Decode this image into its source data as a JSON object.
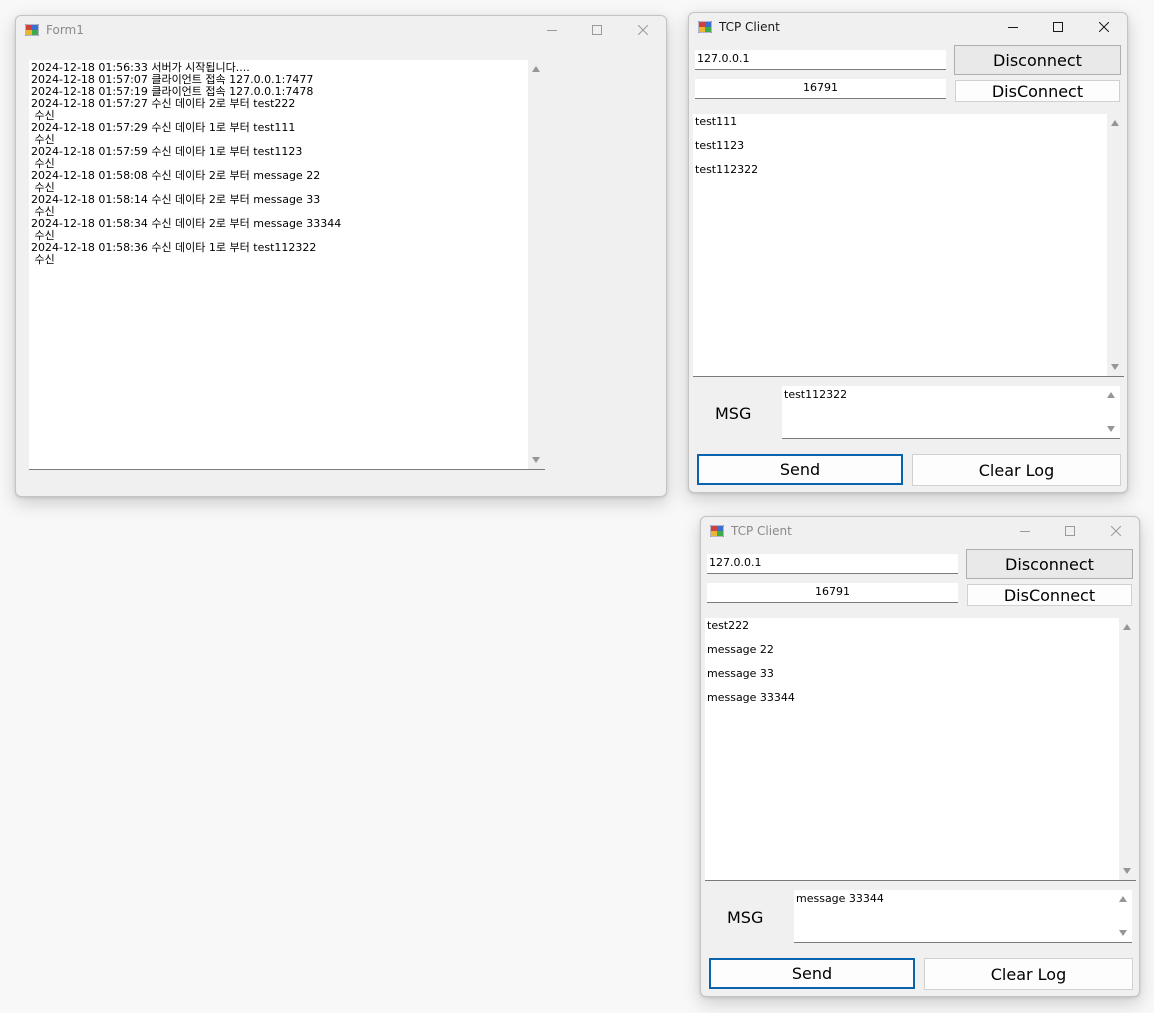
{
  "server": {
    "title": "Form1",
    "log": [
      "2024-12-18 01:56:33 서버가 시작됩니다....",
      "2024-12-18 01:57:07 클라이언트 접속 127.0.0.1:7477",
      "2024-12-18 01:57:19 클라이언트 접속 127.0.0.1:7478",
      "2024-12-18 01:57:27 수신 데이타 2로 부터 test222",
      " 수신",
      "2024-12-18 01:57:29 수신 데이타 1로 부터 test111",
      " 수신",
      "2024-12-18 01:57:59 수신 데이타 1로 부터 test1123",
      " 수신",
      "2024-12-18 01:58:08 수신 데이타 2로 부터 message 22",
      " 수신",
      "2024-12-18 01:58:14 수신 데이타 2로 부터 message 33",
      " 수신",
      "2024-12-18 01:58:34 수신 데이타 2로 부터 message 33344",
      " 수신",
      "2024-12-18 01:58:36 수신 데이타 1로 부터 test112322",
      " 수신"
    ]
  },
  "client1": {
    "title": "TCP Client",
    "ip": "127.0.0.1",
    "port": "16791",
    "disconnect_label": "Disconnect",
    "disconnect2_label": "DisConnect",
    "messages": [
      "test111",
      "test1123",
      "test112322"
    ],
    "msg_label": "MSG",
    "msg_value": "test112322",
    "send_label": "Send",
    "clear_label": "Clear Log"
  },
  "client2": {
    "title": "TCP Client",
    "ip": "127.0.0.1",
    "port": "16791",
    "disconnect_label": "Disconnect",
    "disconnect2_label": "DisConnect",
    "messages": [
      "test222",
      "message 22",
      "message 33",
      "message 33344"
    ],
    "msg_label": "MSG",
    "msg_value": "message 33344",
    "send_label": "Send",
    "clear_label": "Clear Log"
  },
  "icons": {
    "app": "winforms-app-icon",
    "minimize": "minimize-icon",
    "maximize": "maximize-icon",
    "close": "close-icon"
  },
  "colors": {
    "focus_border": "#0a64ad",
    "window_bg": "#f0f0f0"
  }
}
